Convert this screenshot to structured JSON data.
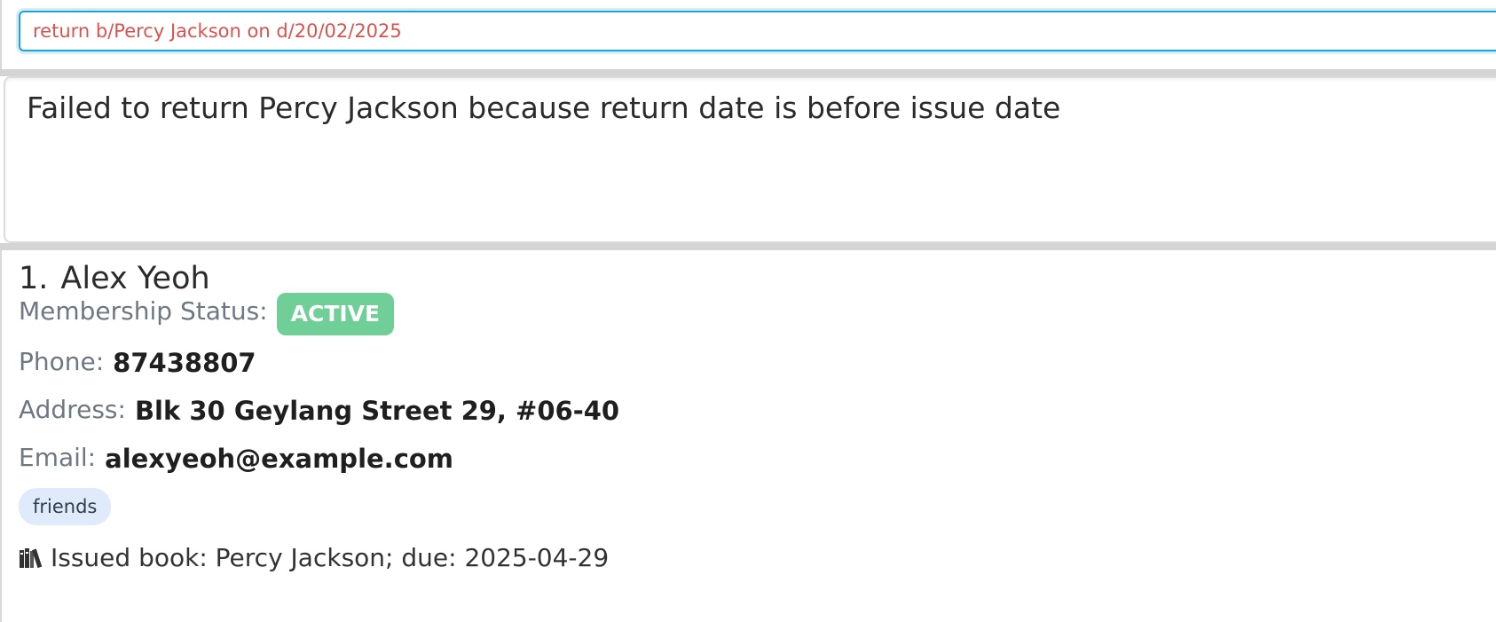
{
  "command": {
    "value": "return b/Percy Jackson on d/20/02/2025"
  },
  "result": {
    "message": "Failed to return Percy Jackson because return date is before issue date"
  },
  "person": {
    "index": "1.",
    "name": "Alex Yeoh",
    "membership_label": "Membership Status:",
    "membership_status": "ACTIVE",
    "phone_label": "Phone:",
    "phone": "87438807",
    "address_label": "Address:",
    "address": "Blk 30 Geylang Street 29, #06-40",
    "email_label": "Email:",
    "email": "alexyeoh@example.com",
    "tags": [
      "friends"
    ],
    "issued_book_icon": "books-icon",
    "issued_book": "Issued book: Percy Jackson; due: 2025-04-29"
  },
  "colors": {
    "command_text": "#d9534f",
    "input_border": "#1ea2dc",
    "status_active": "#6fcf97",
    "tag_bg": "#dfeafb"
  }
}
